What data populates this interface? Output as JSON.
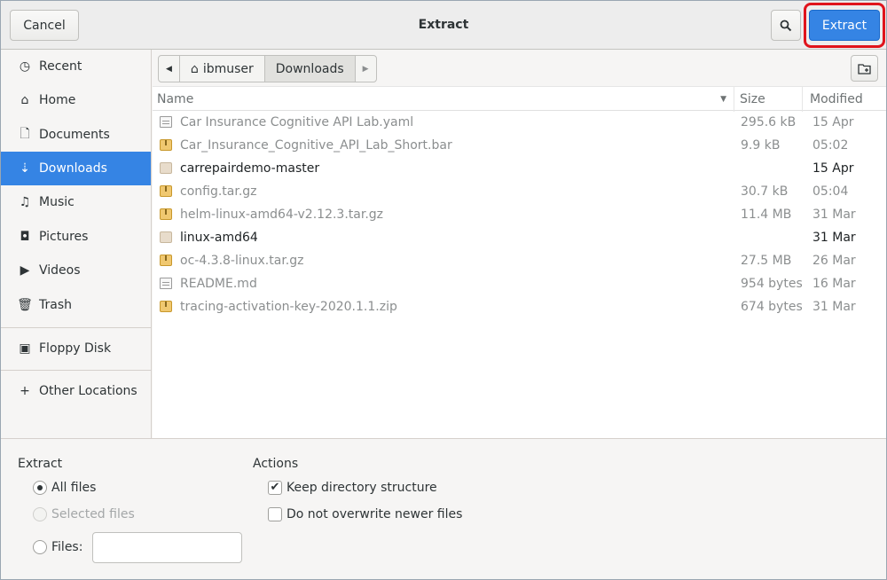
{
  "header": {
    "cancel_label": "Cancel",
    "title": "Extract",
    "search_icon": "search-icon",
    "extract_label": "Extract",
    "highlight_color": "#e0141c",
    "accent_color": "#3584e4"
  },
  "sidebar": {
    "items": [
      {
        "label": "Recent",
        "icon": "clock-icon",
        "glyph": "◷"
      },
      {
        "label": "Home",
        "icon": "home-icon",
        "glyph": "⌂"
      },
      {
        "label": "Documents",
        "icon": "document-icon",
        "glyph": "🗋"
      },
      {
        "label": "Downloads",
        "icon": "download-icon",
        "glyph": "⇣"
      },
      {
        "label": "Music",
        "icon": "music-icon",
        "glyph": "♫"
      },
      {
        "label": "Pictures",
        "icon": "camera-icon",
        "glyph": "◘"
      },
      {
        "label": "Videos",
        "icon": "video-icon",
        "glyph": "▶"
      },
      {
        "label": "Trash",
        "icon": "trash-icon",
        "glyph": "🗑"
      },
      {
        "label": "Floppy Disk",
        "icon": "floppy-icon",
        "glyph": "▣"
      },
      {
        "label": "Other Locations",
        "icon": "plus-icon",
        "glyph": "+"
      }
    ],
    "selected": "Downloads"
  },
  "pathbar": {
    "crumbs": [
      "ibmuser",
      "Downloads"
    ],
    "home_glyph": "⌂",
    "new_folder_icon": "new-folder-icon"
  },
  "filelist": {
    "columns": {
      "name": "Name",
      "size": "Size",
      "modified": "Modified"
    },
    "rows": [
      {
        "name": "Car Insurance Cognitive API Lab.yaml",
        "size": "295.6 kB",
        "modified": "15 Apr",
        "icon": "document-icon"
      },
      {
        "name": "Car_Insurance_Cognitive_API_Lab_Short.bar",
        "size": "9.9 kB",
        "modified": "05:02",
        "icon": "archive-icon"
      },
      {
        "name": "carrepairdemo-master",
        "size": "",
        "modified": "15 Apr",
        "icon": "folder-icon"
      },
      {
        "name": "config.tar.gz",
        "size": "30.7 kB",
        "modified": "05:04",
        "icon": "archive-icon"
      },
      {
        "name": "helm-linux-amd64-v2.12.3.tar.gz",
        "size": "11.4 MB",
        "modified": "31 Mar",
        "icon": "archive-icon"
      },
      {
        "name": "linux-amd64",
        "size": "",
        "modified": "31 Mar",
        "icon": "folder-icon"
      },
      {
        "name": "oc-4.3.8-linux.tar.gz",
        "size": "27.5 MB",
        "modified": "26 Mar",
        "icon": "archive-icon"
      },
      {
        "name": "README.md",
        "size": "954 bytes",
        "modified": "16 Mar",
        "icon": "document-icon"
      },
      {
        "name": "tracing-activation-key-2020.1.1.zip",
        "size": "674 bytes",
        "modified": "31 Mar",
        "icon": "archive-icon"
      }
    ]
  },
  "options": {
    "extract_title": "Extract",
    "all_files": "All files",
    "selected_files": "Selected files",
    "files_label": "Files:",
    "files_value": "",
    "actions_title": "Actions",
    "keep_structure": "Keep directory structure",
    "keep_structure_checked": true,
    "no_overwrite": "Do not overwrite newer files",
    "no_overwrite_checked": false
  }
}
